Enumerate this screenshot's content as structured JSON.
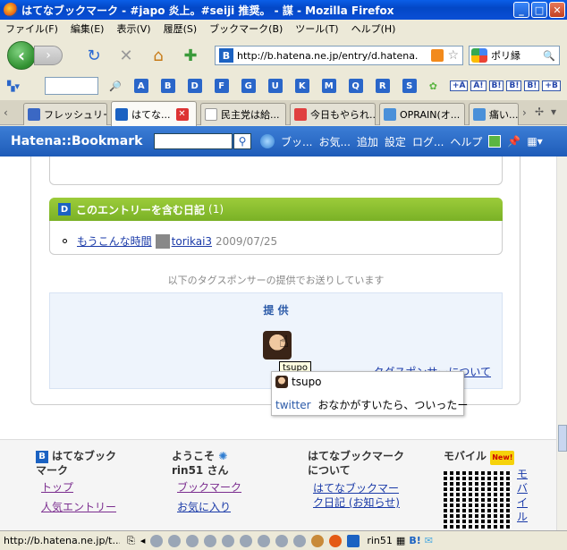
{
  "window": {
    "title": "はてなブックマーク - #japo 炎上。#seiji 推奨。 - 謀 - Mozilla Firefox",
    "minimize": "_",
    "maximize": "□",
    "close": "✕"
  },
  "menu": [
    "ファイル(F)",
    "編集(E)",
    "表示(V)",
    "履歴(S)",
    "ブックマーク(B)",
    "ツール(T)",
    "ヘルプ(H)"
  ],
  "nav": {
    "url": "http://b.hatena.ne.jp/entry/d.hatena.",
    "search_engine": "G",
    "search_value": "ポリ縁"
  },
  "bookmark_toolbar": {
    "letters": [
      "A",
      "B",
      "D",
      "F",
      "G",
      "U",
      "K",
      "M",
      "Q",
      "R",
      "S"
    ],
    "small_buttons": [
      "+A",
      "A!",
      "B!",
      "B!",
      "B!",
      "+B"
    ]
  },
  "tabs": [
    {
      "label": "フレッシュリー...",
      "active": false
    },
    {
      "label": "はてな...",
      "active": true
    },
    {
      "label": "民主党は給...",
      "active": false
    },
    {
      "label": "今日もやられ...",
      "active": false
    },
    {
      "label": "OPRAIN(オ...",
      "active": false
    },
    {
      "label": "痛い...",
      "active": false
    }
  ],
  "hatena_bar": {
    "logo": "Hatena::Bookmark",
    "search_go": "⚲",
    "links": [
      "ブッ...",
      "お気...",
      "追加",
      "設定",
      "ログ...",
      "ヘルプ"
    ]
  },
  "diary": {
    "header": "このエントリーを含む日記",
    "count": "(1)",
    "item": {
      "title": "もうこんな時間",
      "user": "torikai3",
      "date": "2009/07/25"
    }
  },
  "sponsor": {
    "note": "以下のタグスポンサーの提供でお送りしています",
    "label": "提 供",
    "about": "タグスポンサーについて",
    "tooltip": "tsupo",
    "popup_user": "tsupo",
    "popup_source": "twitter",
    "popup_text": "おなかがすいたら、ついったー"
  },
  "footer": {
    "col1": {
      "title": "はてなブックマーク",
      "links": [
        "トップ",
        "人気エントリー"
      ]
    },
    "col2": {
      "title": "ようこそ",
      "user": "rin51 さん",
      "links": [
        "ブックマーク",
        "お気に入り"
      ]
    },
    "col3": {
      "title": "はてなブックマークについて",
      "links": [
        "はてなブックマーク日記 (お知らせ)"
      ]
    },
    "col4": {
      "title": "モバイル",
      "badge": "New!",
      "link": "モバイル"
    }
  },
  "status": {
    "url": "http://b.hatena.ne.jp/t...",
    "user": "rin51"
  }
}
